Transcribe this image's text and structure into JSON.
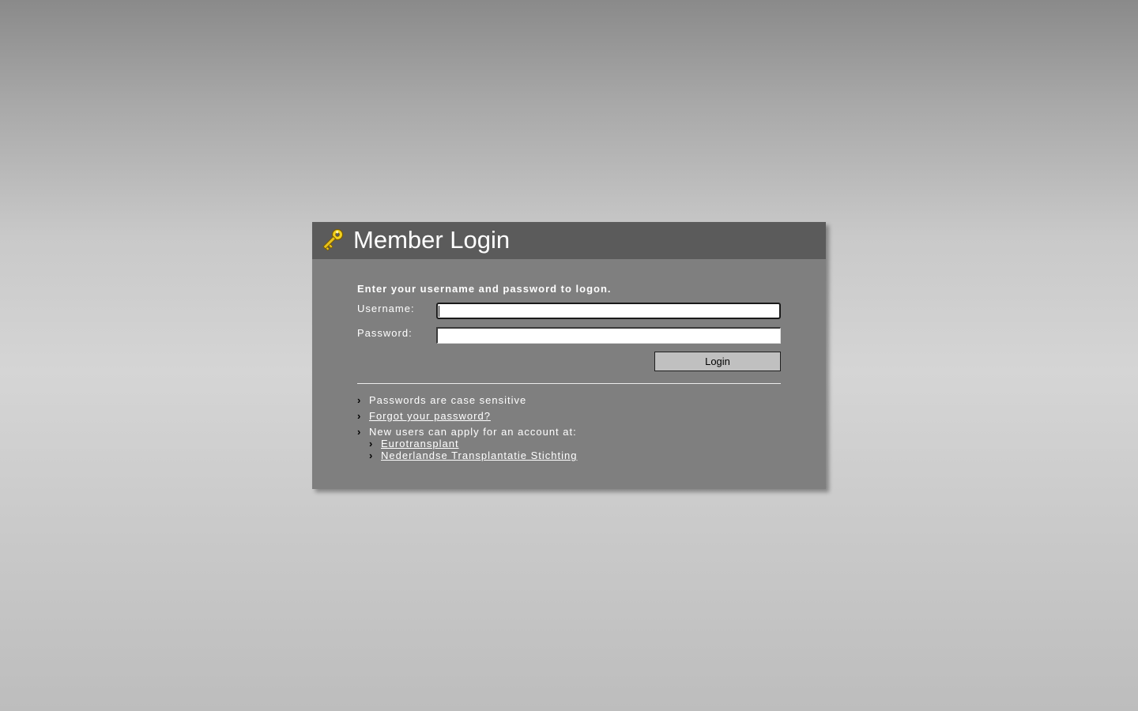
{
  "header": {
    "title": "Member Login",
    "icon": "key-icon"
  },
  "form": {
    "intro": "Enter your username and password to logon.",
    "username_label": "Username:",
    "username_value": "",
    "password_label": "Password:",
    "password_value": "",
    "login_label": "Login"
  },
  "info": {
    "bullet_glyph": "›",
    "case_note": "Passwords are case sensitive",
    "forgot_link": "Forgot your password?",
    "apply_note": "New users can apply for an account at:",
    "apply_links": [
      "Eurotransplant",
      "Nederlandse Transplantatie Stichting"
    ]
  },
  "colors": {
    "header_bg": "#5b5b5b",
    "panel_bg": "#7f7f7f",
    "text": "#ffffff",
    "key_gold": "#e8c21a",
    "button_bg": "#c0c0c0"
  }
}
